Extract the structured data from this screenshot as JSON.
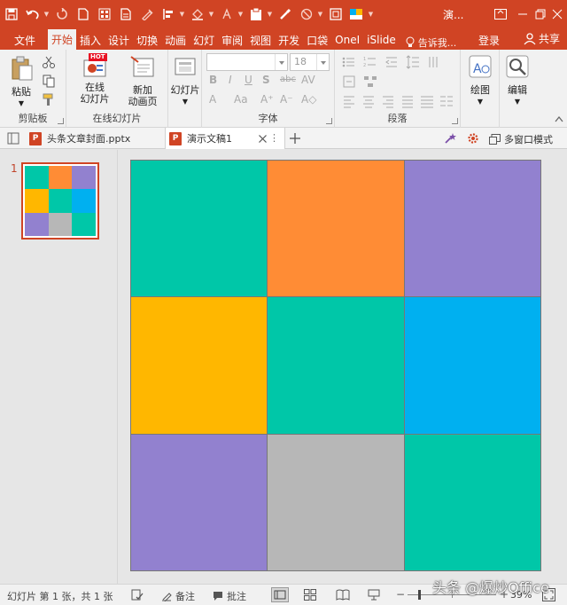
{
  "titlebar": {
    "doc_title": "演...",
    "bg_color": "#d04424"
  },
  "tabs": [
    {
      "label": "文件"
    },
    {
      "label": "开始"
    },
    {
      "label": "插入"
    },
    {
      "label": "设计"
    },
    {
      "label": "切换"
    },
    {
      "label": "动画"
    },
    {
      "label": "幻灯"
    },
    {
      "label": "审阅"
    },
    {
      "label": "视图"
    },
    {
      "label": "开发"
    },
    {
      "label": "口袋"
    },
    {
      "label": "OneI"
    },
    {
      "label": "iSlide"
    }
  ],
  "tell_me": "告诉我...",
  "login": "登录",
  "share": "共享",
  "ribbon": {
    "paste_label": "粘贴",
    "clipboard_group": "剪贴板",
    "online_slides_label": "在线\n幻灯片",
    "hot_badge": "HOT",
    "new_anim_label": "新加\n动画页",
    "online_slides_group": "在线幻灯片",
    "slides_label": "幻灯片",
    "font_size_value": "18",
    "font_group": "字体",
    "paragraph_group": "段落",
    "drawing_label": "绘图",
    "editing_label": "编辑"
  },
  "doc_tabs": [
    {
      "label": "头条文章封面.pptx",
      "active": false
    },
    {
      "label": "演示文稿1",
      "active": true
    }
  ],
  "multi_window_label": "多窗口模式",
  "thumbnail": {
    "number": "1"
  },
  "slide": {
    "cells": [
      "#00c7a8",
      "#ff8c35",
      "#9281cf",
      "#ffb700",
      "#00c7a8",
      "#00b0f0",
      "#9281cf",
      "#b7b7b7",
      "#00c7a8"
    ]
  },
  "status": {
    "slide_info": "幻灯片 第 1 张，共 1 张",
    "notes_label": "备注",
    "comments_label": "批注",
    "zoom": "39%"
  },
  "watermark": "头条 @爆炒Office",
  "colors": {
    "accent": "#d04424",
    "ribbon_bg": "#f1f1f1",
    "workspace_bg": "#e6e6e6"
  }
}
